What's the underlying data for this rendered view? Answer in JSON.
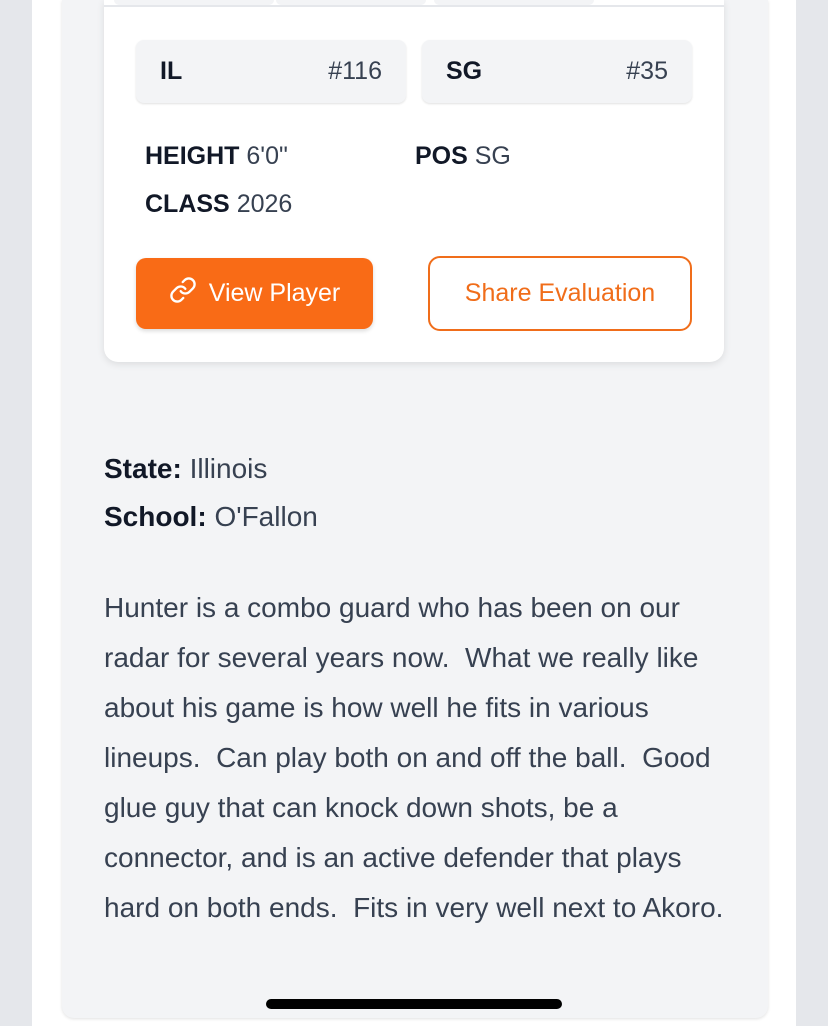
{
  "rankings": [
    {
      "key": "IL",
      "value": "#116"
    },
    {
      "key": "SG",
      "value": "#35"
    }
  ],
  "attributes": {
    "height": {
      "label": "HEIGHT",
      "value": "6'0\""
    },
    "pos": {
      "label": "POS",
      "value": "SG"
    },
    "class": {
      "label": "CLASS",
      "value": "2026"
    }
  },
  "actions": {
    "view_player": "View Player",
    "share_evaluation": "Share Evaluation"
  },
  "info": {
    "state": {
      "label": "State:",
      "value": "Illinois"
    },
    "school": {
      "label": "School:",
      "value": "O'Fallon"
    }
  },
  "description": "Hunter is a combo guard who has been on our radar for several years now.  What we really like about his game is how well he fits in various lineups.  Can play both on and off the ball.  Good glue guy that can knock down shots, be a connector, and is an active defender that plays hard on both ends.  Fits in very well next to Akoro.",
  "colors": {
    "accent": "#f96b16",
    "accent_outline": "#f06d1a",
    "card_bg": "#ffffff",
    "panel_bg": "#f3f4f6"
  },
  "icons": {
    "view_player": "link-icon"
  }
}
